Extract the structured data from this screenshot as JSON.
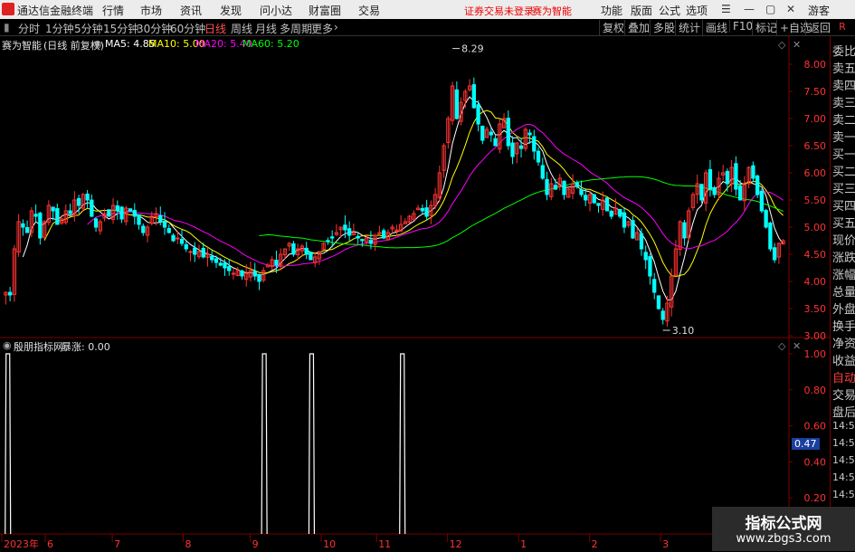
{
  "app": {
    "title": "通达信金融终端",
    "menu": [
      "行情",
      "市场",
      "资讯",
      "发现",
      "问小达",
      "财富圈",
      "交易"
    ],
    "notice": "证券交易未登录",
    "notice2": "赛为智能",
    "right_menu": [
      "功能",
      "版面",
      "公式",
      "选项"
    ],
    "user": "游客"
  },
  "toolbar": {
    "periods": [
      "分时",
      "1分钟",
      "5分钟",
      "15分钟",
      "30分钟",
      "60分钟",
      "日线",
      "周线",
      "月线",
      "多周期",
      "更多"
    ],
    "active": "日线",
    "right_buttons": [
      "复权",
      "叠加",
      "多股",
      "统计",
      "画线",
      "F10",
      "标记",
      "+自选",
      "返回"
    ],
    "r_tab": "R"
  },
  "main_header": {
    "stock": "赛为智能",
    "mode": "(日线 前复权)",
    "ma": [
      {
        "label": "MA5: 4.85",
        "color": "#ffffff"
      },
      {
        "label": "MA10: 5.00",
        "color": "#ffff00"
      },
      {
        "label": "MA20: 5.40",
        "color": "#ff00ff"
      },
      {
        "label": "MA60: 5.20",
        "color": "#00ff00"
      }
    ]
  },
  "sub_header": {
    "indicator": "殷朋指标网",
    "value": "暴涨: 0.00",
    "cursor_value": "0.47"
  },
  "price_axis": [
    "8.00",
    "7.50",
    "7.00",
    "6.50",
    "6.00",
    "5.50",
    "5.00",
    "4.50",
    "4.00",
    "3.50",
    "3.00"
  ],
  "sub_axis": [
    "1.00",
    "0.80",
    "0.60",
    "0.40",
    "0.20"
  ],
  "annotations": {
    "high": "8.29",
    "low": "3.10"
  },
  "date_axis": [
    "2023年",
    "6",
    "7",
    "8",
    "9",
    "10",
    "11",
    "12",
    "1",
    "2",
    "3"
  ],
  "right_panel": [
    "委比",
    "卖五",
    "卖四",
    "卖三",
    "卖二",
    "卖一",
    "买一",
    "买二",
    "买三",
    "买四",
    "买五",
    "现价",
    "涨跌",
    "涨幅",
    "总量",
    "外盘",
    "换手",
    "净资",
    "收益",
    "自动",
    "交易",
    "盘后",
    "14:56",
    "14:56",
    "14:56",
    "14:56",
    "14:56",
    "14:56",
    "14:56",
    "14:56"
  ],
  "watermark": {
    "line1": "指标公式网",
    "line2": "www.zbgs3.com"
  },
  "colors": {
    "up": "#ff3232",
    "down": "#00ffff",
    "ma5": "#ffffff",
    "ma10": "#ffff00",
    "ma20": "#ff00ff",
    "ma60": "#00ff00",
    "grid": "#7a0000"
  },
  "chart_data": {
    "type": "candlestick",
    "ylim": [
      3.0,
      8.3
    ],
    "closes": [
      3.8,
      3.75,
      4.6,
      5.1,
      5.0,
      4.9,
      5.3,
      5.2,
      4.8,
      5.1,
      5.4,
      5.3,
      5.05,
      5.15,
      5.3,
      5.25,
      5.5,
      5.4,
      5.6,
      5.5,
      5.2,
      5.0,
      5.1,
      5.25,
      5.2,
      5.4,
      5.3,
      5.15,
      5.35,
      5.3,
      5.2,
      5.05,
      4.9,
      5.0,
      5.2,
      5.25,
      5.1,
      5.0,
      4.9,
      4.75,
      4.8,
      4.7,
      4.6,
      4.55,
      4.5,
      4.55,
      4.45,
      4.5,
      4.4,
      4.35,
      4.3,
      4.25,
      4.2,
      4.15,
      4.2,
      4.1,
      4.15,
      4.2,
      4.1,
      4.0,
      4.2,
      4.3,
      4.4,
      4.3,
      4.5,
      4.6,
      4.7,
      4.5,
      4.6,
      4.65,
      4.5,
      4.4,
      4.45,
      4.55,
      4.7,
      4.75,
      4.8,
      4.9,
      5.0,
      4.95,
      4.85,
      4.9,
      4.8,
      4.75,
      4.8,
      4.7,
      4.85,
      4.9,
      4.8,
      4.9,
      5.0,
      4.95,
      5.05,
      5.1,
      5.2,
      5.25,
      5.35,
      5.3,
      5.2,
      5.4,
      5.6,
      6.0,
      6.5,
      7.0,
      7.6,
      7.0,
      7.3,
      7.5,
      7.6,
      7.2,
      6.9,
      6.6,
      6.8,
      6.7,
      6.5,
      6.9,
      7.0,
      6.5,
      6.3,
      6.55,
      6.45,
      6.8,
      6.7,
      6.4,
      6.2,
      5.9,
      5.6,
      5.8,
      5.7,
      5.9,
      5.6,
      5.7,
      5.8,
      5.75,
      5.6,
      5.5,
      5.6,
      5.45,
      5.4,
      5.5,
      5.3,
      5.2,
      5.35,
      5.2,
      5.0,
      5.1,
      4.8,
      4.9,
      4.6,
      4.4,
      4.1,
      3.8,
      3.5,
      3.3,
      3.6,
      4.1,
      4.6,
      5.1,
      4.8,
      5.3,
      5.6,
      5.8,
      5.5,
      6.0,
      5.7,
      5.6,
      5.9,
      6.0,
      5.8,
      6.1,
      5.7,
      5.5,
      5.8,
      6.1,
      5.9,
      5.6,
      5.3,
      5.0,
      4.6,
      4.4,
      4.7,
      4.75
    ],
    "ma5": 4.85,
    "ma10": 5.0,
    "ma20": 5.4,
    "ma60": 5.2,
    "signal_positions": [
      0.01,
      0.335,
      0.395,
      0.51
    ],
    "signal_value": 1.0
  }
}
